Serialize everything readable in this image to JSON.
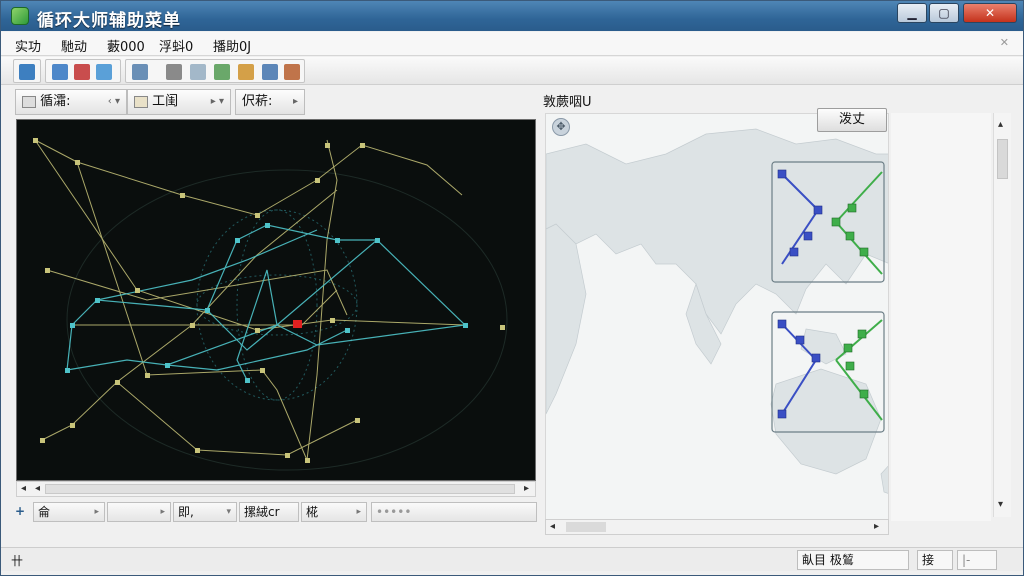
{
  "window": {
    "title": "循环大师辅助菜单"
  },
  "menu": [
    "实功",
    "馳动",
    "藪000",
    "浮蚪0",
    "播助0J"
  ],
  "toolbar": {
    "icons": [
      "open-icon",
      "layout-icon",
      "refresh-icon",
      "link-icon",
      "window-icon",
      "document-icon",
      "draw-icon",
      "globe-icon",
      "home-icon",
      "export-icon",
      "settings-icon"
    ]
  },
  "left_tabs": [
    {
      "label": "循灀:",
      "arrow": "‹ ▾"
    },
    {
      "label": "工闺",
      "arrow": "▸ ▾"
    },
    {
      "label": "伬菥:",
      "arrow": "▸"
    }
  ],
  "left_bottom": [
    {
      "label": "+"
    },
    {
      "label": "侖",
      "arrow": "▸"
    },
    {
      "label": "",
      "arrow": "▸"
    },
    {
      "label": "即,",
      "arrow": "▾"
    },
    {
      "label": "摞絨cr"
    },
    {
      "label": "椛",
      "arrow": "▸"
    },
    {
      "label": "•••••"
    }
  ],
  "right": {
    "header": "敦蕨咽U",
    "zoom_button": "泼丈"
  },
  "status": {
    "left": "卄",
    "item1": "畒目 极鶭",
    "item2": "接",
    "item3": "|-"
  },
  "colors": {
    "titlebar": "#2f6597",
    "graph_bg": "#0a0e0d",
    "edge_yellow": "#c8c47a",
    "edge_cyan": "#4ec3c9",
    "node_blue": "#3a4fc4",
    "node_green": "#3fae4a",
    "selected_node": "#e02020"
  }
}
